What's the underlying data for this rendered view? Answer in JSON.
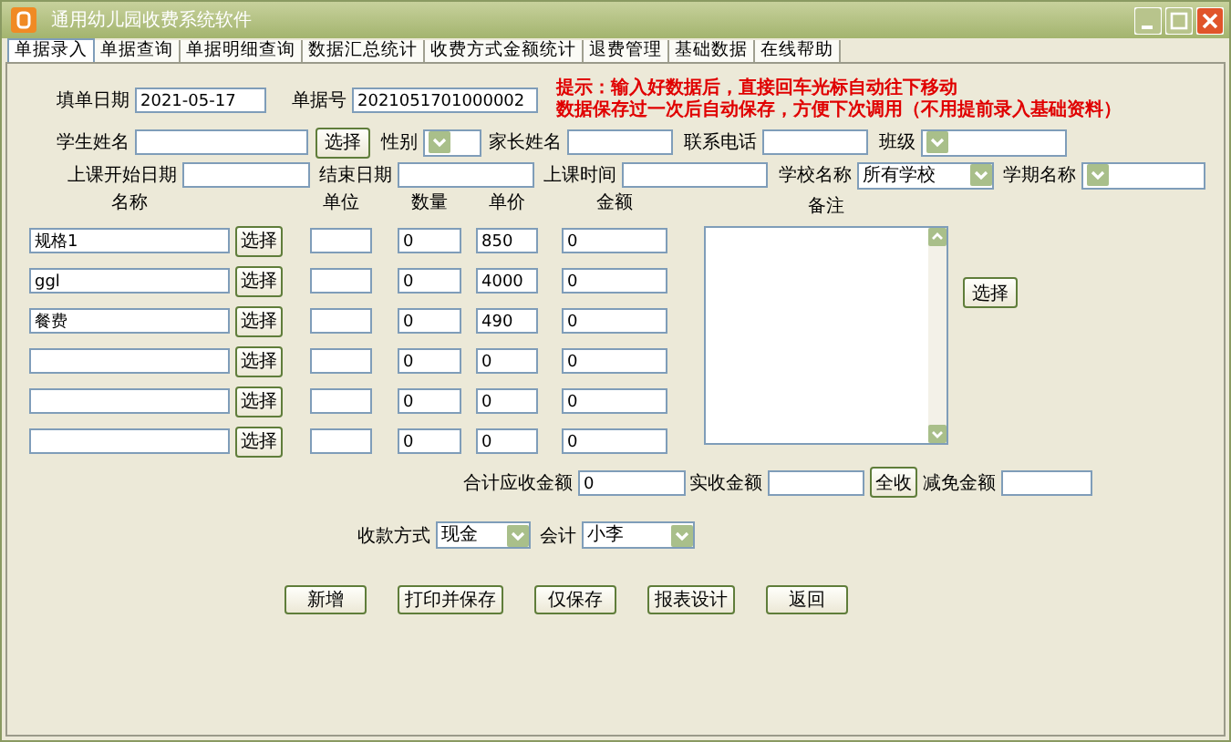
{
  "window": {
    "title": "通用幼儿园收费系统软件"
  },
  "tabs": [
    {
      "label": "单据录入",
      "selected": true
    },
    {
      "label": "单据查询",
      "selected": false
    },
    {
      "label": "单据明细查询",
      "selected": false
    },
    {
      "label": "数据汇总统计",
      "selected": false
    },
    {
      "label": "收费方式金额统计",
      "selected": false
    },
    {
      "label": "退费管理",
      "selected": false
    },
    {
      "label": "基础数据",
      "selected": false
    },
    {
      "label": "在线帮助",
      "selected": false
    }
  ],
  "hint": [
    "提示：输入好数据后，直接回车光标自动往下移动",
    "数据保存过一次后自动保存，方便下次调用（不用提前录入基础资料）"
  ],
  "header_rows": [
    [
      {
        "kind": "text",
        "label": "填单日期",
        "value": "2021-05-17"
      },
      {
        "kind": "text",
        "label": "单据号",
        "value": "2021051701000002"
      }
    ],
    [
      {
        "kind": "text",
        "label": "学生姓名"
      },
      {
        "kind": "button",
        "label": "选择"
      },
      {
        "kind": "select",
        "label": "性别"
      },
      {
        "kind": "text",
        "label": "家长姓名"
      },
      {
        "kind": "text",
        "label": "联系电话"
      },
      {
        "kind": "select",
        "label": "班级"
      }
    ],
    [
      {
        "kind": "text",
        "label": "上课开始日期"
      },
      {
        "kind": "text",
        "label": "结束日期"
      },
      {
        "kind": "text",
        "label": "上课时间"
      },
      {
        "kind": "select",
        "label": "学校名称",
        "value": "所有学校"
      },
      {
        "kind": "select",
        "label": "学期名称"
      }
    ]
  ],
  "columns": [
    "名称",
    "单位",
    "数量",
    "单价",
    "金额"
  ],
  "items": [
    {
      "name": "规格1",
      "button": "选择",
      "quantity": "0",
      "price": "850",
      "amount": "0"
    },
    {
      "name": "ggl",
      "button": "选择",
      "quantity": "0",
      "price": "4000",
      "amount": "0"
    },
    {
      "name": "餐费",
      "button": "选择",
      "quantity": "0",
      "price": "490",
      "amount": "0"
    },
    {
      "button": "选择",
      "quantity": "0",
      "price": "0",
      "amount": "0"
    },
    {
      "button": "选择",
      "quantity": "0",
      "price": "0",
      "amount": "0"
    },
    {
      "button": "选择",
      "quantity": "0",
      "price": "0",
      "amount": "0"
    }
  ],
  "notes": {
    "label": "备注",
    "button": "选择"
  },
  "totals": [
    {
      "kind": "text",
      "label": "合计应收金额",
      "value": "0"
    },
    {
      "kind": "text",
      "label": "实收金额"
    },
    {
      "kind": "button",
      "label": "全收"
    },
    {
      "kind": "text",
      "label": "减免金额"
    }
  ],
  "payment": [
    {
      "kind": "select",
      "label": "收款方式",
      "value": "现金"
    },
    {
      "kind": "select",
      "label": "会计",
      "value": "小李"
    }
  ],
  "actions": [
    "新增",
    "打印并保存",
    "仅保存",
    "报表设计",
    "返回"
  ]
}
